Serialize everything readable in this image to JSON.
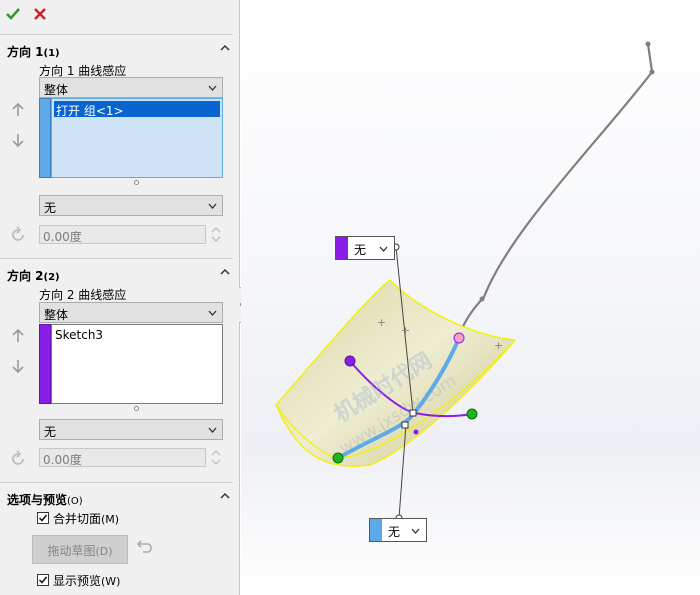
{
  "confirm": {
    "ok_icon": "checkmark-icon",
    "cancel_icon": "x-icon",
    "ok_color": "#2e9a2e",
    "cancel_color": "#cc2020"
  },
  "dir1": {
    "title": "方向 1",
    "count": "(1)",
    "influence_label": "方向 1 曲线感应",
    "mode": "整体",
    "selection": "打开 组<1>",
    "tangency": "无",
    "angle": "0.00度",
    "color": "#5ea9e8"
  },
  "dir2": {
    "title": "方向 2",
    "count": "(2)",
    "influence_label": "方向 2 曲线感应",
    "mode": "整体",
    "selection": "Sketch3",
    "tangency": "无",
    "angle": "0.00度",
    "color": "#8a1ee8"
  },
  "options": {
    "title": "选项与预览",
    "count": "(O)",
    "merge_label": "合并切面",
    "merge_key": "(M)",
    "merge_checked": true,
    "drag_sketch": "拖动草图",
    "drag_key": "(D)",
    "show_preview_label": "显示预览",
    "show_preview_key": "(W)",
    "show_preview_checked": true
  },
  "viewport": {
    "callout_top": "无",
    "callout_bottom": "无",
    "watermark_cn": "机械时代网",
    "watermark_url": "www.jxsdw.com"
  }
}
